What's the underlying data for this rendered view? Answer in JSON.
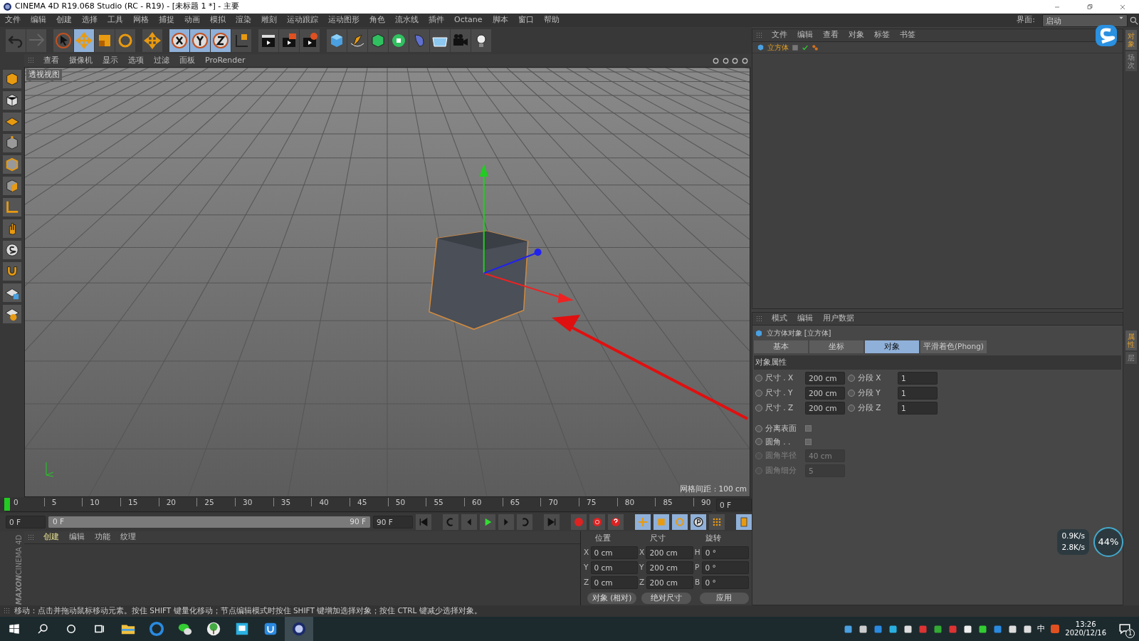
{
  "window": {
    "title": "CINEMA 4D R19.068 Studio (RC - R19) - [未标题 1 *] - 主要"
  },
  "menu": [
    "文件",
    "编辑",
    "创建",
    "选择",
    "工具",
    "网格",
    "捕捉",
    "动画",
    "模拟",
    "渲染",
    "雕刻",
    "运动跟踪",
    "运动图形",
    "角色",
    "流水线",
    "插件",
    "Octane",
    "脚本",
    "窗口",
    "帮助"
  ],
  "interface": {
    "label": "界面:",
    "value": "启动"
  },
  "toolbar": [
    {
      "kind": "undo",
      "selected": false
    },
    {
      "kind": "redo",
      "selected": false
    },
    {
      "kind": "sep"
    },
    {
      "kind": "select",
      "selected": false
    },
    {
      "kind": "move",
      "selected": true
    },
    {
      "kind": "scale",
      "selected": false
    },
    {
      "kind": "rotate",
      "selected": false
    },
    {
      "kind": "sep"
    },
    {
      "kind": "move",
      "selected": false
    },
    {
      "kind": "sep"
    },
    {
      "kind": "axis-x",
      "selected": true
    },
    {
      "kind": "axis-y",
      "selected": true
    },
    {
      "kind": "axis-z",
      "selected": true
    },
    {
      "kind": "coord",
      "selected": false
    },
    {
      "kind": "sep"
    },
    {
      "kind": "render-view",
      "selected": false
    },
    {
      "kind": "render-picture",
      "selected": false
    },
    {
      "kind": "render-settings",
      "selected": false
    },
    {
      "kind": "sep"
    },
    {
      "kind": "cube",
      "selected": false
    },
    {
      "kind": "pen",
      "selected": false
    },
    {
      "kind": "subdivide",
      "selected": false
    },
    {
      "kind": "cloner",
      "selected": false
    },
    {
      "kind": "deformer",
      "selected": false
    },
    {
      "kind": "floor",
      "selected": false
    },
    {
      "kind": "camera",
      "selected": false
    },
    {
      "kind": "light",
      "selected": false
    }
  ],
  "left_tools": [
    {
      "kind": "model"
    },
    {
      "kind": "texture"
    },
    {
      "kind": "workplane"
    },
    {
      "kind": "points"
    },
    {
      "kind": "edges"
    },
    {
      "kind": "polygons"
    },
    {
      "kind": "axis"
    },
    {
      "kind": "tweak"
    },
    {
      "kind": "snap"
    },
    {
      "kind": "magnet"
    },
    {
      "kind": "lock"
    },
    {
      "kind": "grid"
    }
  ],
  "viewport": {
    "menu": [
      "查看",
      "摄像机",
      "显示",
      "选项",
      "过滤",
      "面板",
      "ProRender"
    ],
    "label": "透视视图",
    "grid_info": "网格间距 : 100 cm"
  },
  "object_manager": {
    "menu": [
      "文件",
      "编辑",
      "查看",
      "对象",
      "标签",
      "书签"
    ],
    "objects": [
      {
        "name": "立方体",
        "selected": true
      }
    ]
  },
  "attributes": {
    "menu": [
      "模式",
      "编辑",
      "用户数据"
    ],
    "title": "立方体对象 [立方体]",
    "tabs": [
      {
        "label": "基本",
        "selected": false
      },
      {
        "label": "坐标",
        "selected": false
      },
      {
        "label": "对象",
        "selected": true
      },
      {
        "label": "平滑着色(Phong)",
        "selected": false
      }
    ],
    "section": "对象属性",
    "pairs": [
      {
        "label": "尺寸 . X",
        "value": "200 cm",
        "keyframe": false,
        "label2": "分段 X",
        "value2": "1",
        "keyframe2": false
      },
      {
        "label": "尺寸 . Y",
        "value": "200 cm",
        "keyframe": false,
        "label2": "分段 Y",
        "value2": "1",
        "keyframe2": false
      },
      {
        "label": "尺寸 . Z",
        "value": "200 cm",
        "keyframe": false,
        "label2": "分段 Z",
        "value2": "1",
        "keyframe2": false
      }
    ],
    "options": [
      {
        "kind": "check",
        "label": "分离表面",
        "checked": false,
        "disabled": false,
        "keyframe": false
      },
      {
        "kind": "check",
        "label": "圆角 . .",
        "checked": false,
        "disabled": false,
        "keyframe": false
      },
      {
        "kind": "field",
        "label": "圆角半径",
        "value": "40 cm",
        "disabled": true,
        "keyframe": false
      },
      {
        "kind": "field",
        "label": "圆角细分",
        "value": "5",
        "disabled": true,
        "keyframe": false
      }
    ]
  },
  "side_tabs_top": [
    {
      "label": "对象",
      "selected": true
    },
    {
      "label": "场次",
      "selected": false
    }
  ],
  "side_tabs_bottom": [
    {
      "label": "属性",
      "selected": true
    },
    {
      "label": "层",
      "selected": false
    }
  ],
  "timeline": {
    "ticks": [
      "0",
      "5",
      "10",
      "15",
      "20",
      "25",
      "30",
      "35",
      "40",
      "45",
      "50",
      "55",
      "60",
      "65",
      "70",
      "75",
      "80",
      "85",
      "90"
    ],
    "current": "0 F",
    "level": 0
  },
  "transport": {
    "start": "0 F",
    "range_start": "0 F",
    "range_end": "90 F",
    "end": "90 F",
    "level": 1
  },
  "materials": {
    "menu": [
      "创建",
      "编辑",
      "功能",
      "纹理"
    ]
  },
  "logo": [
    "MAXON",
    "CINEMA 4D"
  ],
  "coordinates": {
    "headers": [
      "位置",
      "尺寸",
      "旋转"
    ],
    "rows": [
      {
        "a": "X",
        "p": "0 cm",
        "b": "X",
        "s": "200 cm",
        "c": "H",
        "r": "0 °"
      },
      {
        "a": "Y",
        "p": "0 cm",
        "b": "Y",
        "s": "200 cm",
        "c": "P",
        "r": "0 °"
      },
      {
        "a": "Z",
        "p": "0 cm",
        "b": "Z",
        "s": "200 cm",
        "c": "B",
        "r": "0 °"
      }
    ],
    "mode": "对象 (相对)",
    "size_mode": "绝对尺寸",
    "apply": "应用"
  },
  "status_bar": "移动：点击并拖动鼠标移动元素。按住 SHIFT 键量化移动；节点编辑模式时按住 SHIFT 键增加选择对象；按住 CTRL 键减少选择对象。",
  "monitor": {
    "up": "0.9K/s",
    "down": "2.8K/s",
    "percent": "44%"
  },
  "taskbar": {
    "apps": [
      {
        "kind": "folder",
        "active": false
      },
      {
        "kind": "browser",
        "active": false
      },
      {
        "kind": "chat",
        "active": false
      },
      {
        "kind": "tree",
        "active": false
      },
      {
        "kind": "doc",
        "active": false
      },
      {
        "kind": "bag",
        "active": false
      },
      {
        "kind": "c4d",
        "active": true
      }
    ],
    "ime": "中",
    "time": "13:26",
    "date": "2020/12/16",
    "notifications": "1"
  }
}
